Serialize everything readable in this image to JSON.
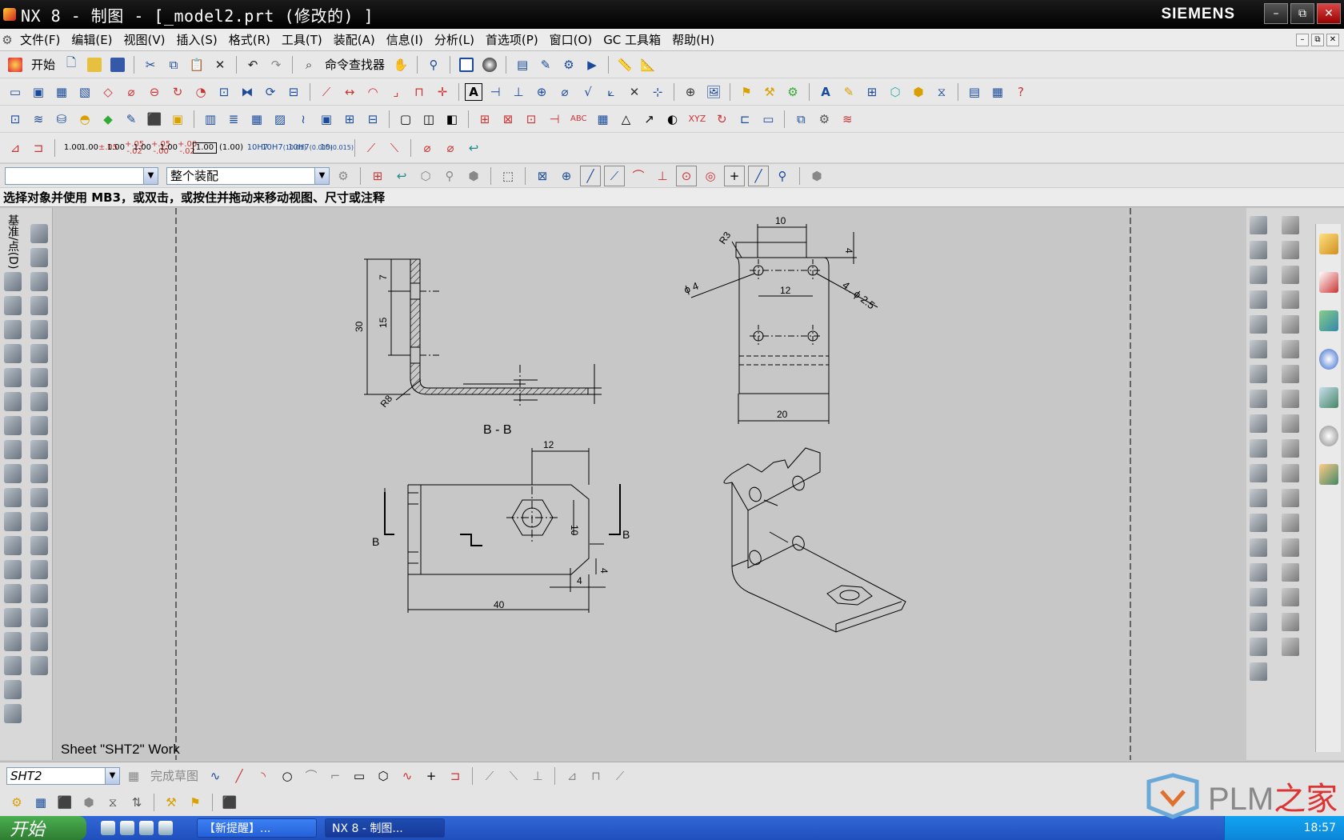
{
  "window": {
    "title": "NX 8 - 制图 - [_model2.prt  (修改的) ]",
    "brand": "SIEMENS",
    "controls": [
      "–",
      "⧉",
      "✕"
    ]
  },
  "menu": [
    "文件(F)",
    "编辑(E)",
    "视图(V)",
    "插入(S)",
    "格式(R)",
    "工具(T)",
    "装配(A)",
    "信息(I)",
    "分析(L)",
    "首选项(P)",
    "窗口(O)",
    "GC 工具箱",
    "帮助(H)"
  ],
  "toolbar": {
    "start_label": "开始",
    "command_finder_label": "命令查找器",
    "dim_formats": [
      {
        "t": "1.00",
        "s": ""
      },
      {
        "t": "1.00",
        "s": "±.05"
      },
      {
        "t": "1.00",
        "s": "+.05 -.02"
      },
      {
        "t": "1.00",
        "s": "+.05 -.00"
      },
      {
        "t": "1.00",
        "s": "+.00 -.02"
      },
      {
        "t": "1.00",
        "s": ""
      },
      {
        "t": "(1.00)",
        "s": ""
      },
      {
        "t": "10H7",
        "s": ""
      },
      {
        "t": "10H7",
        "s": "(10.01)"
      },
      {
        "t": "10H7",
        "s": "(0.015)"
      },
      {
        "t": "10",
        "s": "(0.015)"
      }
    ],
    "abc_label": "ABC",
    "xyz_label": "XYZ"
  },
  "selection": {
    "filter_value": "",
    "scope_value": "整个装配"
  },
  "status": {
    "prompt": "选择对象并使用 MB3，或双击，或按住并拖动来移动视图、尺寸或注释"
  },
  "left_palette": {
    "tab_label": "基准/点(D)"
  },
  "drawing": {
    "sheet_label": "Sheet \"SHT2\" Work",
    "section_label": "B - B",
    "section_marker": "B",
    "dims": {
      "d30": "30",
      "d15": "15",
      "d7": "7",
      "r8": "R8",
      "d10_top": "10",
      "d4_top": "4",
      "d12_mid": "12",
      "phi4": "ϕ 4",
      "phi25": "4 . ϕ 2.5",
      "r3": "R3",
      "d20": "20",
      "d12_front": "12",
      "d10_front": "10",
      "d4_a": "4",
      "d4_b": "4",
      "d40": "40"
    }
  },
  "bottom": {
    "sheet_value": "SHT2",
    "finish_sketch": "完成草图"
  },
  "taskbar": {
    "start": "开始",
    "tasks": [
      "【新提醒】...",
      "NX 8 - 制图..."
    ],
    "clock": "18:57"
  },
  "watermark": {
    "brand": "PLM",
    "brand_cn": "之家"
  },
  "colors": {
    "titlebar": "#000000",
    "canvas": "#c7c7c7",
    "taskbar": "#245edb",
    "start": "#3c9c3c"
  }
}
